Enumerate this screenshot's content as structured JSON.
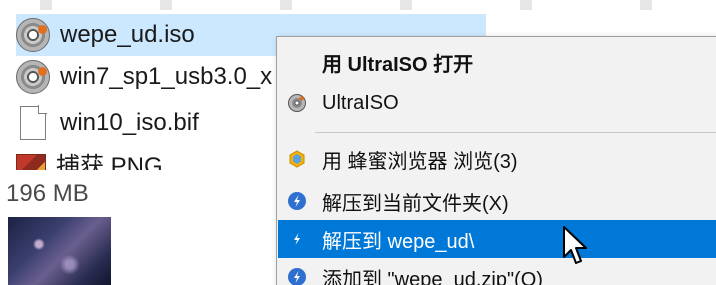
{
  "files": [
    {
      "name": "wepe_ud.iso",
      "icon": "disc-image-icon",
      "selected": true
    },
    {
      "name": "win7_sp1_usb3.0_x",
      "icon": "disc-image-icon",
      "selected": false
    },
    {
      "name": "win10_iso.bif",
      "icon": "document-icon",
      "selected": false
    },
    {
      "name": "捕获.PNG",
      "icon": "png-image-icon",
      "selected": false
    }
  ],
  "status": {
    "size": "196 MB"
  },
  "context_menu": {
    "items": [
      {
        "label": "用 UltraISO 打开",
        "icon": "",
        "bold": true
      },
      {
        "label": "UltraISO",
        "icon": "ultraiso-icon"
      },
      {
        "label": "用 蜂蜜浏览器 浏览(3)",
        "icon": "honeyview-icon"
      },
      {
        "label": "解压到当前文件夹(X)",
        "icon": "bandizip-icon"
      },
      {
        "label": "解压到 wepe_ud\\",
        "icon": "bandizip-icon",
        "highlighted": true
      },
      {
        "label": "添加到 \"wepe_ud.zip\"(Q)",
        "icon": "bandizip-icon"
      }
    ]
  },
  "colors": {
    "selection": "#cce8ff",
    "menu_highlight": "#0078d7",
    "menu_background": "#f2f2f2"
  }
}
